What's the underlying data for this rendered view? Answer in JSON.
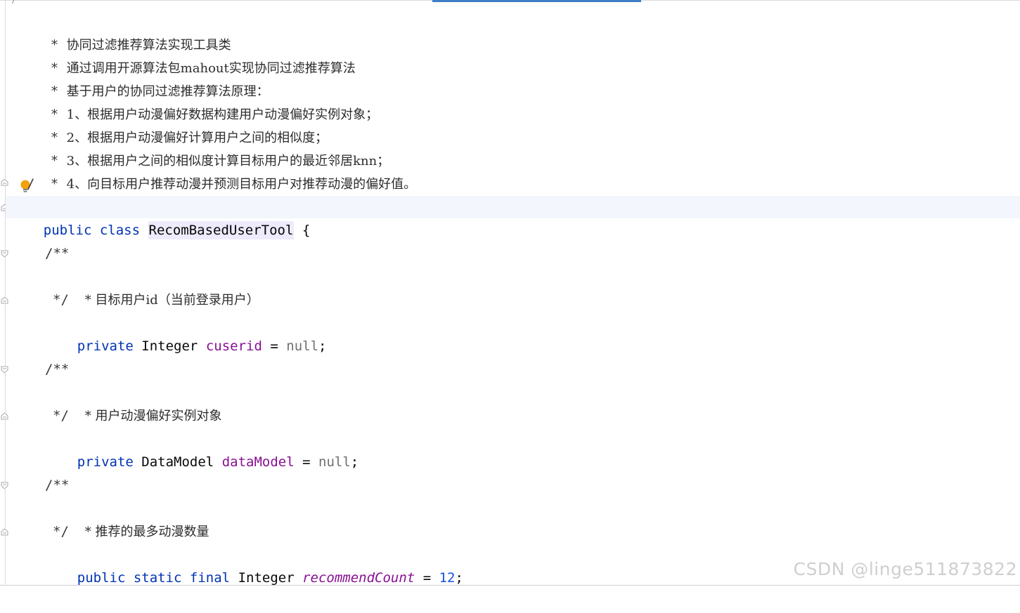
{
  "editor": {
    "top_partial": "/**",
    "doc_comment": [
      {
        "star": "*",
        "text": "协同过滤推荐算法实现工具类"
      },
      {
        "star": "*",
        "text": "通过调用开源算法包mahout实现协同过滤推荐算法"
      },
      {
        "star": "*",
        "text": "基于用户的协同过滤推荐算法原理："
      },
      {
        "star": "*",
        "text": "1、根据用户动漫偏好数据构建用户动漫偏好实例对象；"
      },
      {
        "star": "*",
        "text": "2、根据用户动漫偏好计算用户之间的相似度；"
      },
      {
        "star": "*",
        "text": "3、根据用户之间的相似度计算目标用户的最近邻居knn；"
      },
      {
        "star": "*",
        "text": "4、向目标用户推荐动漫并预测目标用户对推荐动漫的偏好值。"
      }
    ],
    "doc_close": "/",
    "class_decl": {
      "kw_public": "public",
      "kw_class": "class",
      "name": "RecomBasedUserTool",
      "brace": "{"
    },
    "fields": [
      {
        "comment_open": "/**",
        "comment_text": "* 目标用户id（当前登录用户）",
        "comment_close": "*/",
        "modifiers": "private",
        "type": "Integer",
        "name": "cuserid",
        "eq": "=",
        "value": "null",
        "end": ";"
      },
      {
        "comment_open": "/**",
        "comment_text": "* 用户动漫偏好实例对象",
        "comment_close": "*/",
        "modifiers": "private",
        "type": "DataModel",
        "name": "dataModel",
        "eq": "=",
        "value": "null",
        "end": ";"
      },
      {
        "comment_open": "/**",
        "comment_text": "* 推荐的最多动漫数量",
        "comment_close": "*/",
        "modifiers": "public static final",
        "type": "Integer",
        "name": "recommendCount",
        "eq": "=",
        "value": "12",
        "end": ";"
      }
    ]
  },
  "icons": {
    "bulb": "lightbulb-icon",
    "fold": "fold-marker-icon"
  },
  "colors": {
    "keyword": "#0033b3",
    "field": "#871094",
    "number": "#1750eb",
    "null": "#707070",
    "accent": "#3d7fc6"
  },
  "watermark": "CSDN @linge511873822"
}
